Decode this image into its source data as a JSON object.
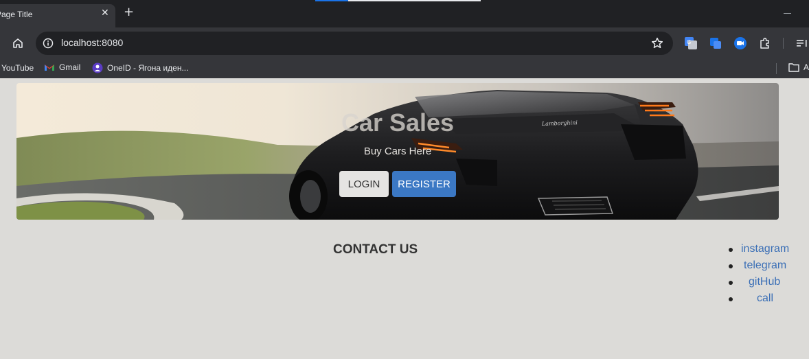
{
  "browser": {
    "tab_title": "Page Title",
    "tab_close": "✕",
    "new_tab": "+",
    "url": "localhost:8080",
    "bookmarks": {
      "youtube": "YouTube",
      "gmail": "Gmail",
      "oneid": "OneID - Ягона иден...",
      "folder": "A"
    }
  },
  "hero": {
    "title": "Car Sales",
    "subtitle": "Buy Cars Here",
    "login_label": "LOGIN",
    "register_label": "REGISTER"
  },
  "contact": {
    "title": "CONTACT US",
    "links": [
      "instagram",
      "telegram",
      "gitHub",
      "call"
    ]
  },
  "colors": {
    "page_bg": "#dcdbd8",
    "chrome_dark": "#202124",
    "chrome_toolbar": "#35363a",
    "register_btn": "#3b78c4",
    "login_btn": "#e5e4e2",
    "link": "#3b6fb6"
  }
}
